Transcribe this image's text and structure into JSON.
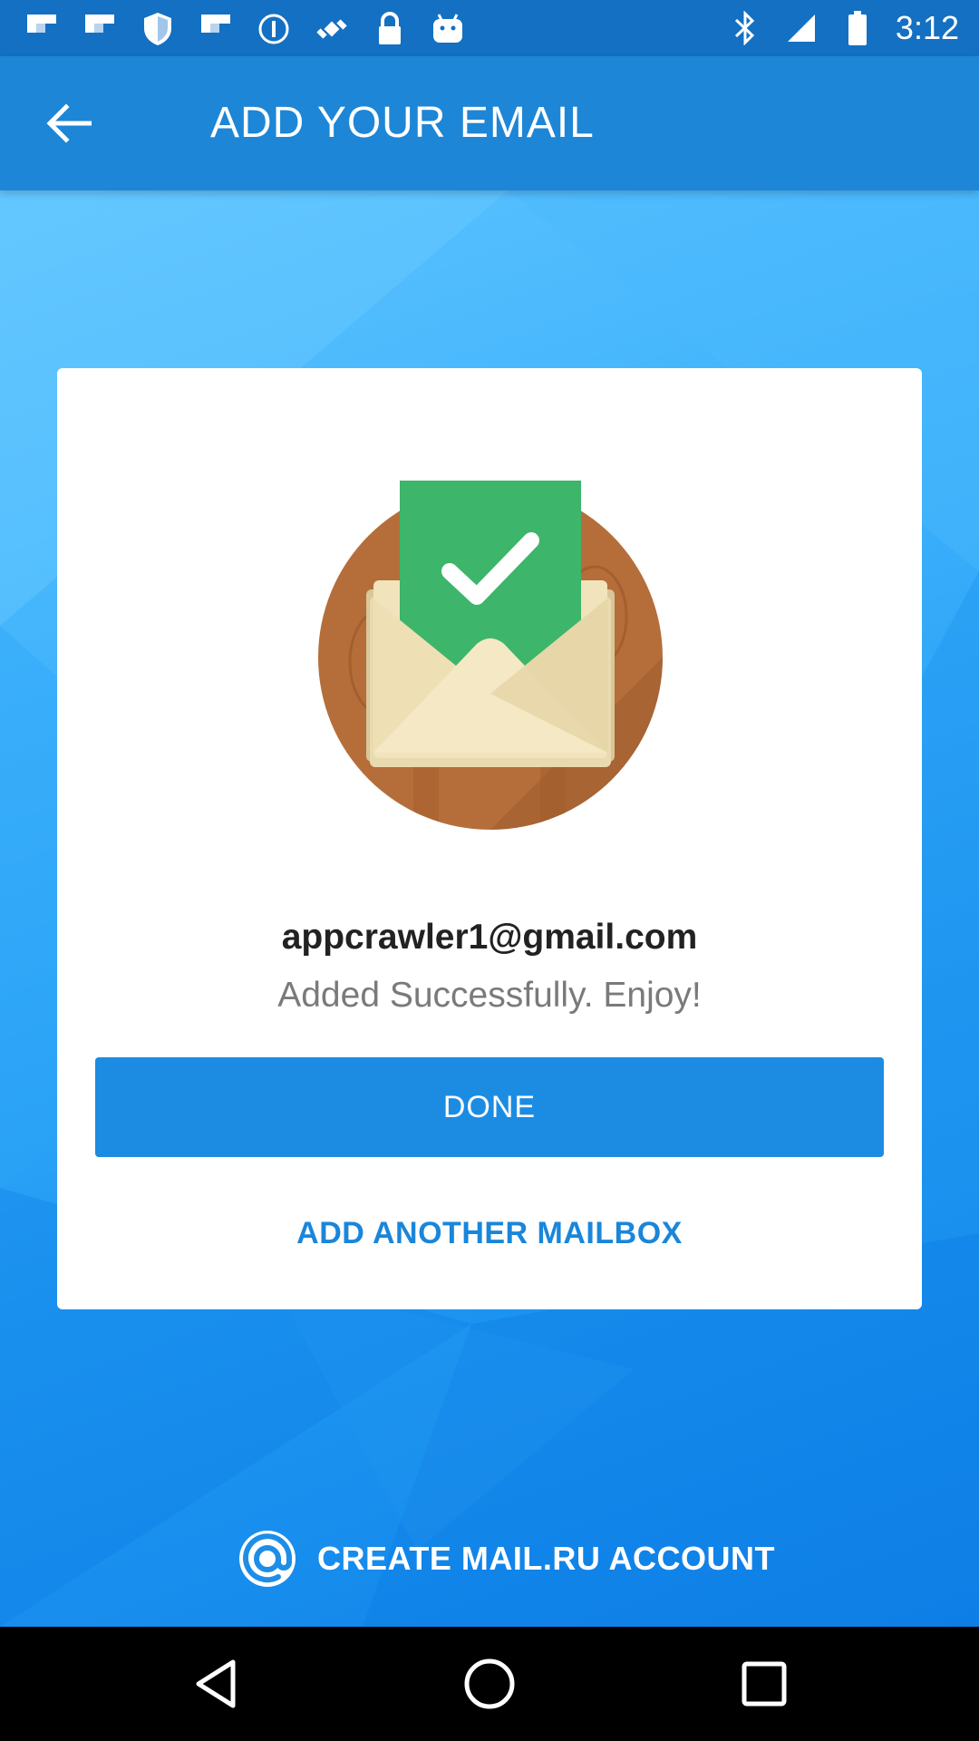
{
  "status_bar": {
    "time": "3:12",
    "icons": [
      "flipboard-icon",
      "flipboard-icon",
      "shield-icon",
      "flipboard-icon",
      "info-icon",
      "fake-gps-icon",
      "lock-icon",
      "android-icon",
      "bluetooth-icon",
      "signal-icon",
      "battery-icon"
    ]
  },
  "header": {
    "title": "ADD YOUR EMAIL",
    "back_icon": "arrow-back-icon"
  },
  "card": {
    "email": "appcrawler1@gmail.com",
    "message": "Added Successfully. Enjoy!",
    "done_label": "DONE",
    "add_another_label": "ADD ANOTHER MAILBOX"
  },
  "footer": {
    "create_account_label": "CREATE MAIL.RU ACCOUNT",
    "create_account_icon": "at-sign-icon"
  },
  "nav": {
    "icons": [
      "back-triangle-icon",
      "home-circle-icon",
      "recents-square-icon"
    ]
  },
  "colors": {
    "app_bar": "#1d86d6",
    "accent": "#1c8ce3",
    "success_green": "#3db56a"
  }
}
